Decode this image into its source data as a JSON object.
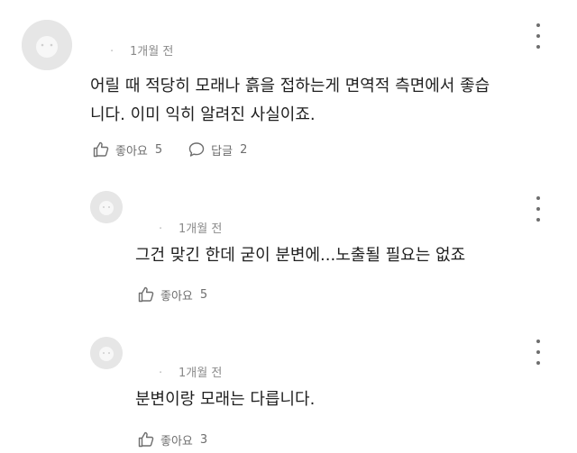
{
  "comments": [
    {
      "author": "·",
      "time": "1개월 전",
      "text_lines": [
        "어릴 때 적당히 모래나 흙을 접하는게 면역적 측면에서 좋습",
        "니다. 이미 익히 알려진 사실이죠."
      ],
      "like_label": "좋아요",
      "like_count": "5",
      "reply_label": "답글",
      "reply_count": "2"
    },
    {
      "author": "·",
      "time": "1개월 전",
      "text_lines": [
        "그건 맞긴 한데 굳이 분변에...노출될 필요는 없죠"
      ],
      "like_label": "좋아요",
      "like_count": "5"
    },
    {
      "author": "·",
      "time": "1개월 전",
      "text_lines": [
        "분변이랑 모래는 다릅니다."
      ],
      "like_label": "좋아요",
      "like_count": "3"
    }
  ],
  "icons": {
    "like": "thumbs-up-icon",
    "reply": "speech-bubble-icon",
    "more": "more-vertical-icon",
    "avatar": "default-avatar-icon"
  },
  "colors": {
    "text": "#1f1f1f",
    "meta": "#8a8a8a",
    "action": "#6e6e6e",
    "avatar_bg": "#e6e6e6"
  }
}
